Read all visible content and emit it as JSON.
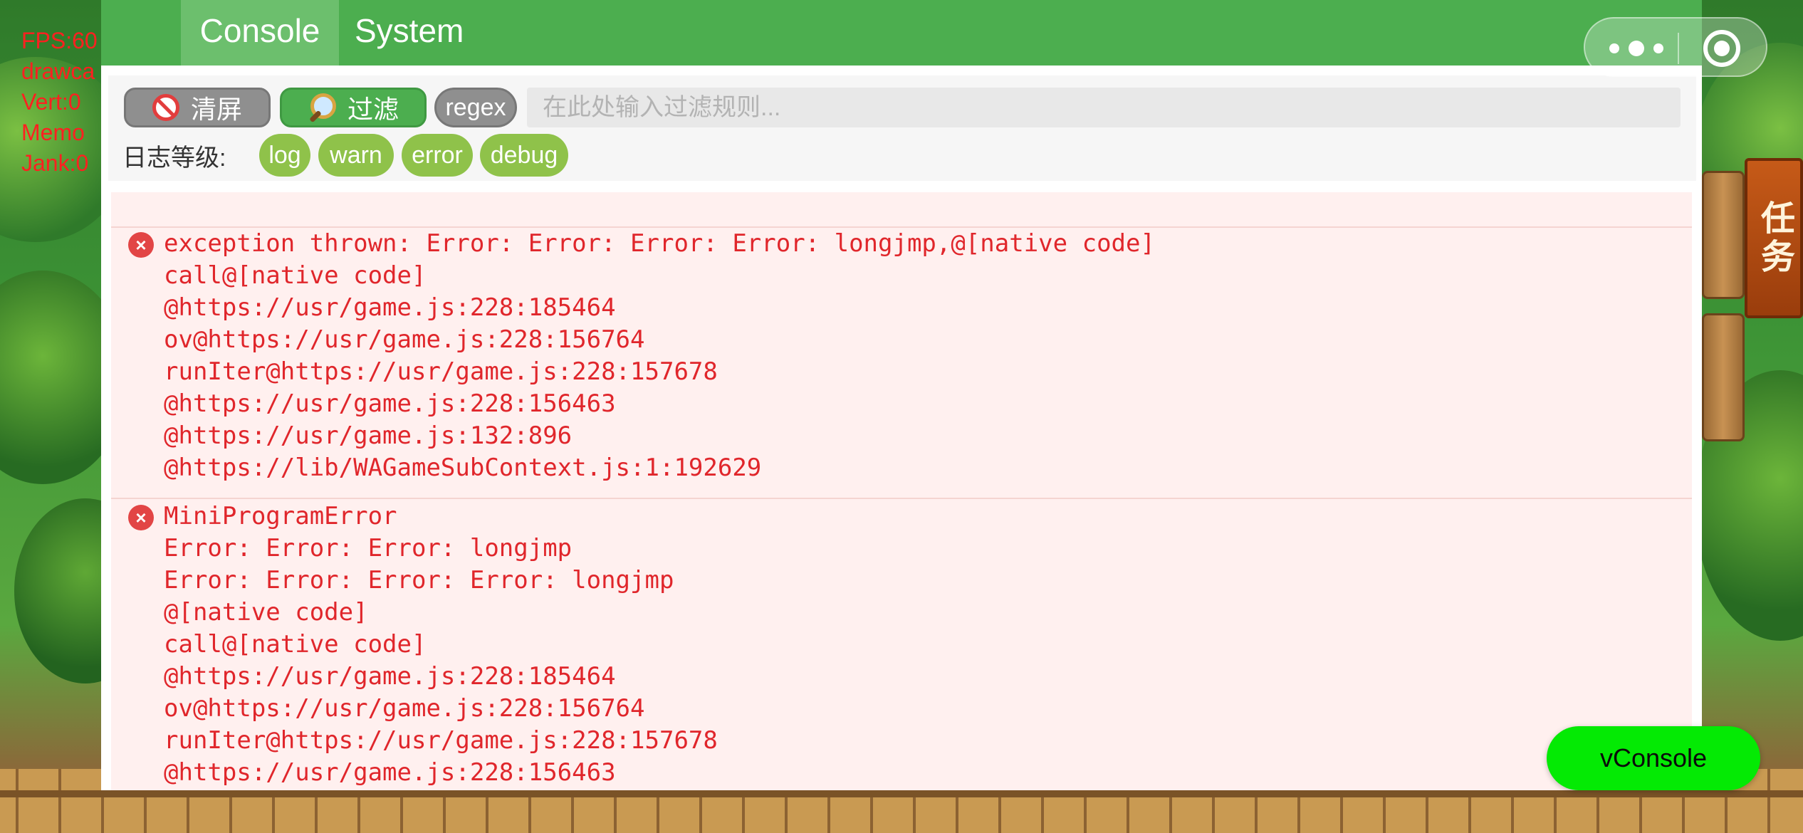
{
  "stats_overlay": {
    "lines": [
      "FPS:60",
      "drawca",
      "Vert:0",
      "Memo",
      "Jank:0"
    ]
  },
  "tabs": [
    {
      "label": "Console",
      "active": true
    },
    {
      "label": "System",
      "active": false
    }
  ],
  "toolbar": {
    "clear_label": "清屏",
    "clear_icon": "no-entry-icon",
    "filter_label": "过滤",
    "filter_icon": "magnifier-icon",
    "regex_label": "regex",
    "filter_placeholder": "在此处输入过滤规则...",
    "filter_value": "",
    "level_label": "日志等级:",
    "levels": [
      "log",
      "warn",
      "error",
      "debug"
    ]
  },
  "logs": [
    {
      "level": "error",
      "lines": [
        "exception thrown: Error: Error: Error: Error: longjmp,@[native code]",
        "call@[native code]",
        "@https://usr/game.js:228:185464",
        "ov@https://usr/game.js:228:156764",
        "runIter@https://usr/game.js:228:157678",
        "@https://usr/game.js:228:156463",
        "@https://usr/game.js:132:896",
        "@https://lib/WAGameSubContext.js:1:192629"
      ]
    },
    {
      "level": "error",
      "lines": [
        "MiniProgramError",
        "Error: Error: Error: longjmp",
        "Error: Error: Error: Error: longjmp",
        "@[native code]",
        "call@[native code]",
        "@https://usr/game.js:228:185464",
        "ov@https://usr/game.js:228:156764",
        "runIter@https://usr/game.js:228:157678",
        "@https://usr/game.js:228:156463"
      ]
    }
  ],
  "game": {
    "task_label": "任务"
  },
  "floating_button": {
    "label": "vConsole"
  },
  "colors": {
    "tabbar": "#4cae4f",
    "tab_active": "#6cbf6d",
    "level_chip": "#8fc24a",
    "log_error_text": "#e0262b",
    "log_error_bg": "#fff0ef",
    "vconsole_button": "#04ea04"
  }
}
